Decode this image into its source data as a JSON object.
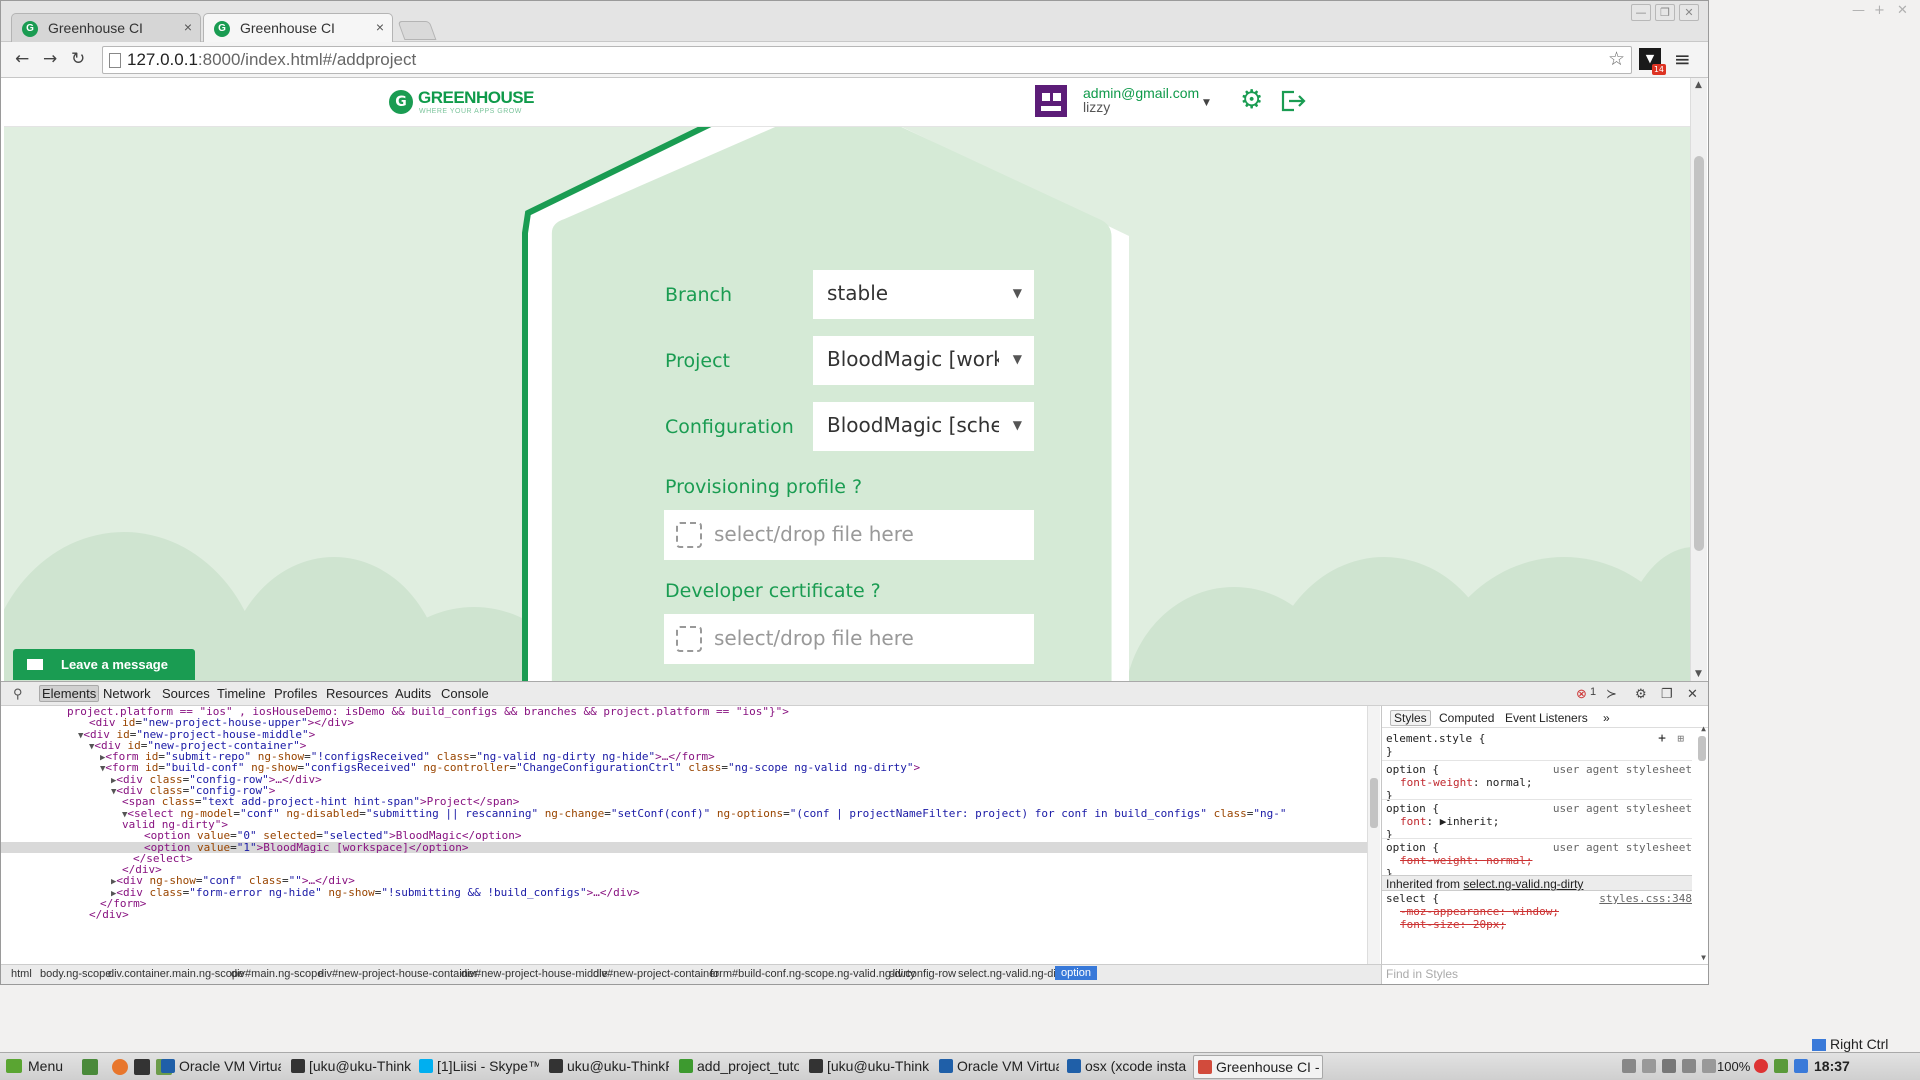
{
  "browser": {
    "tabs": [
      {
        "title": "Greenhouse CI",
        "close": "×"
      },
      {
        "title": "Greenhouse CI",
        "close": "×"
      }
    ],
    "url_host": "127.0.0.1",
    "url_rest": ":8000/index.html#/addproject",
    "extension_badge": "14",
    "window_controls": [
      "—",
      "❐",
      "✕"
    ],
    "desktop_controls": [
      "—",
      "+",
      "✕"
    ]
  },
  "app": {
    "logo_name": "GREENHOUSE",
    "logo_tagline": "WHERE YOUR APPS GROW",
    "user_email": "admin@gmail.com",
    "user_name": "lizzy",
    "form": {
      "branch_label": "Branch",
      "branch_value": "stable",
      "project_label": "Project",
      "project_value": "BloodMagic [workspace]",
      "configuration_label": "Configuration",
      "configuration_value": "BloodMagic [scheme]",
      "provisioning_label": "Provisioning profile ?",
      "developer_cert_label": "Developer certificate ?",
      "drop_placeholder": "select/drop file here"
    },
    "chat_label": "Leave a message"
  },
  "devtools": {
    "tabs": [
      "Elements",
      "Network",
      "Sources",
      "Timeline",
      "Profiles",
      "Resources",
      "Audits",
      "Console"
    ],
    "error_count": "1",
    "side_tabs": [
      "Styles",
      "Computed",
      "Event Listeners",
      "»"
    ],
    "code_lines": [
      {
        "indent": 6,
        "tri": "",
        "html": "project.platform == \"ios\" , iosHouseDemo: isDemo && build_configs && branches && project.platform == \"ios\"}\">"
      },
      {
        "indent": 8,
        "tri": "",
        "tag": "div",
        "attrs": [
          [
            "id",
            "new-project-house-upper"
          ]
        ],
        "close": "></div>"
      },
      {
        "indent": 7,
        "tri": "▼",
        "tag": "div",
        "attrs": [
          [
            "id",
            "new-project-house-middle"
          ]
        ],
        "close": ">"
      },
      {
        "indent": 8,
        "tri": "▼",
        "tag": "div",
        "attrs": [
          [
            "id",
            "new-project-container"
          ]
        ],
        "close": ">"
      },
      {
        "indent": 9,
        "tri": "▶",
        "tag": "form",
        "attrs": [
          [
            "id",
            "submit-repo"
          ],
          [
            "ng-show",
            "!configsReceived"
          ],
          [
            "class",
            "ng-valid ng-dirty ng-hide"
          ]
        ],
        "close": ">…</form>"
      },
      {
        "indent": 9,
        "tri": "▼",
        "tag": "form",
        "attrs": [
          [
            "id",
            "build-conf"
          ],
          [
            "ng-show",
            "configsReceived"
          ],
          [
            "ng-controller",
            "ChangeConfigurationCtrl"
          ],
          [
            "class",
            "ng-scope ng-valid ng-dirty"
          ]
        ],
        "close": ">"
      },
      {
        "indent": 10,
        "tri": "▶",
        "tag": "div",
        "attrs": [
          [
            "class",
            "config-row"
          ]
        ],
        "close": ">…</div>"
      },
      {
        "indent": 10,
        "tri": "▼",
        "tag": "div",
        "attrs": [
          [
            "class",
            "config-row"
          ]
        ],
        "close": ">"
      },
      {
        "indent": 11,
        "tri": "",
        "tag": "span",
        "attrs": [
          [
            "class",
            "text add-project-hint hint-span"
          ]
        ],
        "close": ">Project</span>"
      },
      {
        "indent": 11,
        "tri": "▼",
        "tag": "select",
        "attrs": [
          [
            "ng-model",
            "conf"
          ],
          [
            "ng-disabled",
            "submitting || rescanning"
          ],
          [
            "ng-change",
            "setConf(conf)"
          ],
          [
            "ng-options",
            "(conf | projectNameFilter: project) for conf in build_configs"
          ],
          [
            "class",
            "ng-"
          ]
        ],
        "close": ""
      },
      {
        "indent": 11,
        "tri": "",
        "html": "valid ng-dirty\">"
      },
      {
        "indent": 13,
        "tri": "",
        "tag": "option",
        "attrs": [
          [
            "value",
            "0"
          ],
          [
            "selected",
            "selected"
          ]
        ],
        "close": ">BloodMagic</option>"
      },
      {
        "indent": 13,
        "tri": "",
        "tag": "option",
        "attrs": [
          [
            "value",
            "1"
          ]
        ],
        "close": ">BloodMagic [workspace]</option>",
        "selected": true
      },
      {
        "indent": 12,
        "tri": "",
        "html": "</select>"
      },
      {
        "indent": 11,
        "tri": "",
        "html": "</div>"
      },
      {
        "indent": 10,
        "tri": "▶",
        "tag": "div",
        "attrs": [
          [
            "ng-show",
            "conf"
          ],
          [
            "class",
            ""
          ]
        ],
        "close": ">…</div>"
      },
      {
        "indent": 10,
        "tri": "▶",
        "tag": "div",
        "attrs": [
          [
            "class",
            "form-error ng-hide"
          ],
          [
            "ng-show",
            "!submitting && !build_configs"
          ]
        ],
        "close": ">…</div>"
      },
      {
        "indent": 9,
        "tri": "",
        "html": "</form>"
      },
      {
        "indent": 8,
        "tri": "",
        "html": "</div>"
      }
    ],
    "styles": {
      "element_style": "element.style {",
      "rules": [
        {
          "selector": "option {",
          "source": "user agent stylesheet",
          "prop": "font-weight",
          "val": "normal;",
          "strike": false
        },
        {
          "selector": "option {",
          "source": "user agent stylesheet",
          "prop": "font",
          "val": "▶inherit;",
          "strike": false
        },
        {
          "selector": "option {",
          "source": "user agent stylesheet",
          "prop": "font-weight",
          "val": "normal;",
          "strike": true
        }
      ],
      "inherited_prefix": "Inherited from ",
      "inherited_from": "select.ng-valid.ng-dirty",
      "select_rule": "select {",
      "select_source": "styles.css:348",
      "select_props": [
        "-moz-appearance: window;",
        "font-size: 20px;"
      ],
      "close_brace": "}"
    },
    "breadcrumbs": [
      "html",
      "body.ng-scope",
      "div.container.main.ng-scope",
      "div#main.ng-scope",
      "div#new-project-house-container",
      "div#new-project-house-middle",
      "div#new-project-container",
      "form#build-conf.ng-scope.ng-valid.ng-dirty",
      "div.config-row",
      "select.ng-valid.ng-dirty",
      "option"
    ],
    "find_placeholder": "Find in Styles"
  },
  "taskbar": {
    "menu_label": "Menu",
    "tasks": [
      {
        "label": "Oracle VM VirtualB...",
        "color": "#1f5fa8"
      },
      {
        "label": "[uku@uku-ThinkPa...",
        "color": "#333333"
      },
      {
        "label": "[1]Liisi - Skype™",
        "color": "#00aff0"
      },
      {
        "label": "uku@uku-ThinkPa...",
        "color": "#333333"
      },
      {
        "label": "add_project_tutori...",
        "color": "#3d9a2f"
      },
      {
        "label": "[uku@uku-ThinkPa...",
        "color": "#333333"
      },
      {
        "label": "Oracle VM VirtualB...",
        "color": "#1f5fa8"
      },
      {
        "label": "osx (xcode installe...",
        "color": "#1f5fa8"
      },
      {
        "label": "Greenhouse CI - G...",
        "color": "#d24b3c",
        "active": true
      }
    ],
    "tray_text": "100%",
    "time": "18:37",
    "right_ctrl": "Right Ctrl"
  },
  "colors": {
    "brand_green": "#1a9c52",
    "light_green": "#d5ead6",
    "devtools_select": "#3879d9"
  }
}
